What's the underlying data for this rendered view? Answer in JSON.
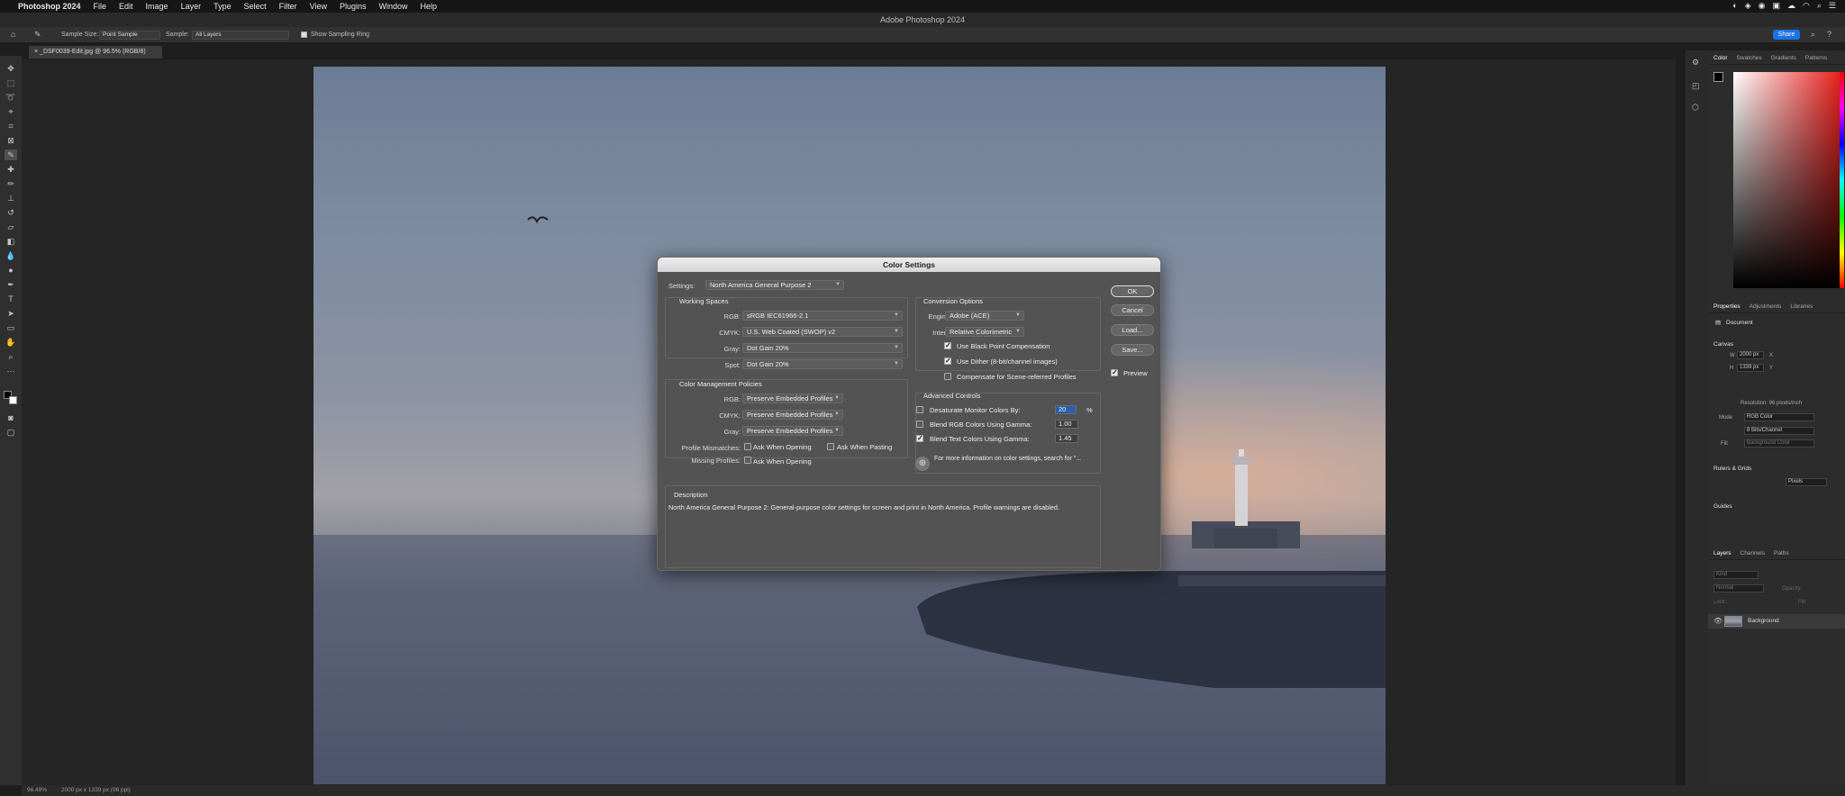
{
  "menubar": {
    "app": "Photoshop 2024",
    "items": [
      "File",
      "Edit",
      "Image",
      "Layer",
      "Type",
      "Select",
      "Filter",
      "View",
      "Plugins",
      "Window",
      "Help"
    ]
  },
  "window": {
    "title": "Adobe Photoshop 2024"
  },
  "options": {
    "sample_size_label": "Sample Size:",
    "sample_size": "Point Sample",
    "sample_label": "Sample:",
    "sample": "All Layers",
    "show_ring": "Show Sampling Ring",
    "share": "Share"
  },
  "document": {
    "tab": "_DSF0039-Edit.jpg @ 96.5% (RGB/8)"
  },
  "status": {
    "zoom": "96.49%",
    "info": "2000 px x 1339 px (96 ppi)"
  },
  "color_panel": {
    "tabs": [
      "Color",
      "Swatches",
      "Gradients",
      "Patterns"
    ]
  },
  "properties": {
    "tabs": [
      "Properties",
      "Adjustments",
      "Libraries"
    ],
    "doc": "Document",
    "canvas": "Canvas",
    "w_label": "W",
    "w": "2000 px",
    "h_label": "H",
    "h": "1339 px",
    "x_label": "X",
    "y_label": "Y",
    "resolution": "Resolution: 96 pixels/inch",
    "mode_label": "Mode",
    "mode": "RGB Color",
    "bits": "8 Bits/Channel",
    "fill_label": "Fill",
    "fill": "Background Color",
    "rulers": "Rulers & Grids",
    "units": "Pixels",
    "guides": "Guides"
  },
  "layers": {
    "tabs": [
      "Layers",
      "Channels",
      "Paths"
    ],
    "kind": "Kind",
    "blend": "Normal",
    "opacity": "Opacity:",
    "lock": "Lock:",
    "fill": "Fill:",
    "layer_name": "Background"
  },
  "dialog": {
    "title": "Color Settings",
    "settings_label": "Settings:",
    "settings": "North America General Purpose 2",
    "working_spaces": "Working Spaces",
    "rgb_label": "RGB:",
    "rgb": "sRGB IEC61966-2.1",
    "cmyk_label": "CMYK:",
    "cmyk": "U.S. Web Coated (SWOP) v2",
    "gray_label": "Gray:",
    "gray": "Dot Gain 20%",
    "spot_label": "Spot:",
    "spot": "Dot Gain 20%",
    "policies": "Color Management Policies",
    "p_rgb": "Preserve Embedded Profiles",
    "p_cmyk": "Preserve Embedded Profiles",
    "p_gray": "Preserve Embedded Profiles",
    "mismatch_label": "Profile Mismatches:",
    "ask_open": "Ask When Opening",
    "ask_paste": "Ask When Pasting",
    "missing_label": "Missing Profiles:",
    "ask_open2": "Ask When Opening",
    "conversion": "Conversion Options",
    "engine_label": "Engine:",
    "engine": "Adobe (ACE)",
    "intent_label": "Intent:",
    "intent": "Relative Colorimetric",
    "bpc": "Use Black Point Compensation",
    "dither": "Use Dither (8-bit/channel images)",
    "scene": "Compensate for Scene-referred Profiles",
    "advanced": "Advanced Controls",
    "desat": "Desaturate Monitor Colors By:",
    "desat_val": "20",
    "pct": "%",
    "blend_rgb": "Blend RGB Colors Using Gamma:",
    "blend_rgb_val": "1.00",
    "blend_text": "Blend Text Colors Using Gamma:",
    "blend_text_val": "1.45",
    "info": "For more information on color settings, search for \"...",
    "description_title": "Description",
    "description": "North America General Purpose 2:  General-purpose color settings for screen and print in North America. Profile warnings are disabled.",
    "ok": "OK",
    "cancel": "Cancel",
    "load": "Load...",
    "save": "Save...",
    "preview": "Preview"
  }
}
